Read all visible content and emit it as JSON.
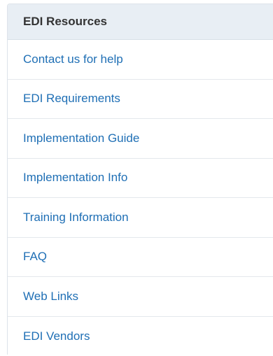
{
  "sidebar": {
    "heading": "EDI Resources",
    "items": [
      {
        "label": "Contact us for help"
      },
      {
        "label": "EDI Requirements"
      },
      {
        "label": "Implementation Guide"
      },
      {
        "label": "Implementation Info"
      },
      {
        "label": "Training Information"
      },
      {
        "label": "FAQ"
      },
      {
        "label": "Web Links"
      },
      {
        "label": "EDI Vendors"
      }
    ]
  },
  "colors": {
    "heading_bg": "#e8eef4",
    "link": "#1f6fb5",
    "divider": "#e4e8ec"
  }
}
